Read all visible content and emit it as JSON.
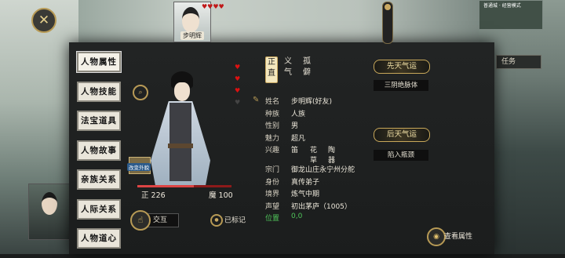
{
  "top": {
    "avatar_name": "步明辉",
    "hearts": "♥♥♥♥",
    "close_label": "✕",
    "minimap_label": "普通城 · 经营模式"
  },
  "tabs": [
    "人物属性",
    "人物技能",
    "法宝道具",
    "人物故事",
    "亲族关系",
    "人际关系",
    "人物道心"
  ],
  "character": {
    "badge": "改变外貌",
    "zheng_label": "正",
    "zheng_value": "226",
    "mo_label": "魔",
    "mo_value": "100",
    "hp_fraction": 0.6,
    "interact_label": "交互",
    "marked_label": "已标记"
  },
  "heart_marks": [
    "♥",
    "♥",
    "♥",
    "♥"
  ],
  "attr_tabs": [
    "正直",
    "义气",
    "孤僻"
  ],
  "info": {
    "name_k": "姓名",
    "name_v": "步明辉(好友)",
    "race_k": "种族",
    "race_v": "人族",
    "sex_k": "性别",
    "sex_v": "男",
    "charm_k": "魅力",
    "charm_v": "超凡",
    "hobby_k": "兴趣",
    "hobby_1": "笛",
    "hobby_2": "花草",
    "hobby_3": "陶器",
    "sect_k": "宗门",
    "sect_v": "御龙山庄永宁州分舵",
    "rank_k": "身份",
    "rank_v": "真传弟子",
    "realm_k": "境界",
    "realm_v": "炼气中期",
    "rep_k": "声望",
    "rep_v": "初出茅庐（1005）",
    "pos_k": "位置",
    "pos_v": "0,0"
  },
  "fortune": {
    "innate_label": "先天气运",
    "innate_value": "三阴绝脉体",
    "acquired_label": "后天气运",
    "acquired_value": "陷入瓶颈"
  },
  "right": {
    "task_label": "任务",
    "view_attr_label": "查看属性"
  }
}
